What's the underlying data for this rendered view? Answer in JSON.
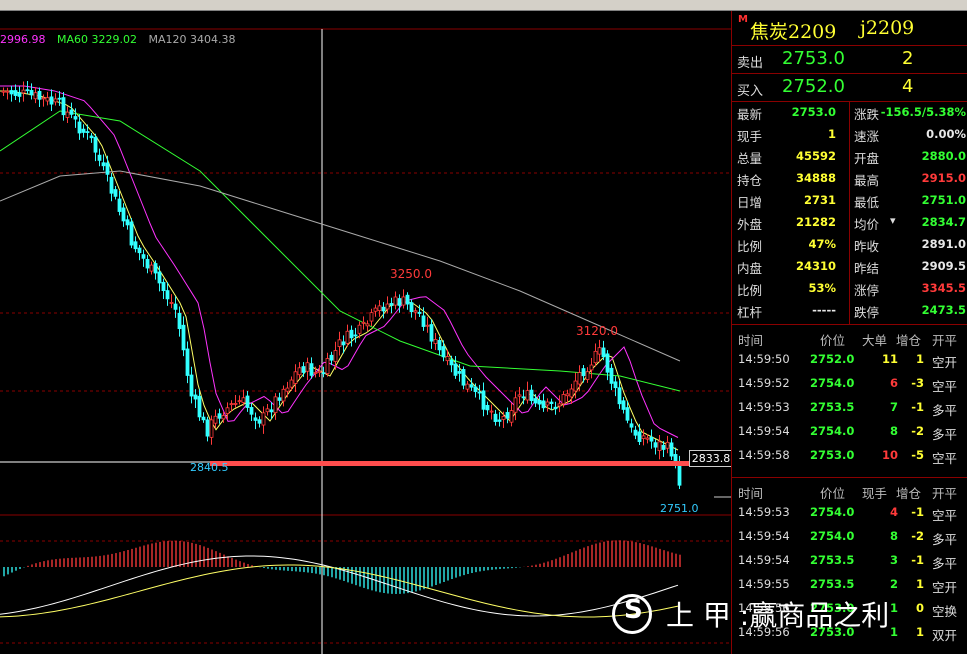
{
  "chart": {
    "ma_legend": [
      {
        "text": "2996.98",
        "color": "#ff33ff"
      },
      {
        "text": "MA60 3229.02",
        "color": "#33ff33"
      },
      {
        "text": "MA120 3404.38",
        "color": "#aaaaaa"
      }
    ],
    "annotations": {
      "high_1": "3250.0",
      "high_2": "3120.0",
      "low_1": "2840.5",
      "last": "2751.0",
      "crosshair_price": "2833.8"
    }
  },
  "quote": {
    "badge": "M",
    "name": "焦炭2209",
    "code": "j2209",
    "ask": {
      "label": "卖出",
      "price": "2753.0",
      "volume": "2"
    },
    "bid": {
      "label": "买入",
      "price": "2752.0",
      "volume": "4"
    },
    "stats": [
      {
        "l1": "最新",
        "v1": "2753.0",
        "c1": "green",
        "l2": "涨跌",
        "v2": "-156.5/5.38%",
        "c2": "green"
      },
      {
        "l1": "现手",
        "v1": "1",
        "c1": "yellow",
        "l2": "速涨",
        "v2": "0.00%",
        "c2": "white"
      },
      {
        "l1": "总量",
        "v1": "45592",
        "c1": "yellow",
        "l2": "开盘",
        "v2": "2880.0",
        "c2": "green"
      },
      {
        "l1": "持仓",
        "v1": "34888",
        "c1": "yellow",
        "l2": "最高",
        "v2": "2915.0",
        "c2": "red"
      },
      {
        "l1": "日增",
        "v1": "2731",
        "c1": "yellow",
        "l2": "最低",
        "v2": "2751.0",
        "c2": "green"
      },
      {
        "l1": "外盘",
        "v1": "21282",
        "c1": "yellow",
        "l2": "均价",
        "v2": "2834.7",
        "c2": "green"
      },
      {
        "l1": "比例",
        "v1": "47%",
        "c1": "yellow",
        "l2": "昨收",
        "v2": "2891.0",
        "c2": "white"
      },
      {
        "l1": "内盘",
        "v1": "24310",
        "c1": "yellow",
        "l2": "昨结",
        "v2": "2909.5",
        "c2": "white"
      },
      {
        "l1": "比例",
        "v1": "53%",
        "c1": "yellow",
        "l2": "涨停",
        "v2": "3345.5",
        "c2": "red"
      },
      {
        "l1": "杠杆",
        "v1": "-----",
        "c1": "white",
        "l2": "跌停",
        "v2": "2473.5",
        "c2": "green"
      }
    ]
  },
  "ticks1": {
    "headers": [
      "时间",
      "价位",
      "大单",
      "增仓",
      "开平"
    ],
    "rows": [
      {
        "time": "14:59:50",
        "price": "2752.0",
        "vol": "11",
        "vc": "yellow",
        "chg": "1",
        "type": "空开"
      },
      {
        "time": "14:59:52",
        "price": "2754.0",
        "vol": "6",
        "vc": "red",
        "chg": "-3",
        "type": "空平"
      },
      {
        "time": "14:59:53",
        "price": "2753.5",
        "vol": "7",
        "vc": "green",
        "chg": "-1",
        "type": "多平"
      },
      {
        "time": "14:59:54",
        "price": "2754.0",
        "vol": "8",
        "vc": "green",
        "chg": "-2",
        "type": "多平"
      },
      {
        "time": "14:59:58",
        "price": "2753.0",
        "vol": "10",
        "vc": "red",
        "chg": "-5",
        "type": "空平"
      }
    ]
  },
  "ticks2": {
    "headers": [
      "时间",
      "价位",
      "现手",
      "增仓",
      "开平"
    ],
    "rows": [
      {
        "time": "14:59:53",
        "price": "2754.0",
        "vol": "4",
        "vc": "red",
        "chg": "-1",
        "type": "空平"
      },
      {
        "time": "14:59:54",
        "price": "2754.0",
        "vol": "8",
        "vc": "green",
        "chg": "-2",
        "type": "多平"
      },
      {
        "time": "14:59:54",
        "price": "2753.5",
        "vol": "3",
        "vc": "green",
        "chg": "-1",
        "type": "多平"
      },
      {
        "time": "14:59:55",
        "price": "2753.5",
        "vol": "2",
        "vc": "green",
        "chg": "1",
        "type": "空开"
      },
      {
        "time": "14:59:56",
        "price": "2753.0",
        "vol": "1",
        "vc": "green",
        "chg": "0",
        "type": "空换"
      },
      {
        "time": "14:59:56",
        "price": "2753.0",
        "vol": "1",
        "vc": "green",
        "chg": "1",
        "type": "双开"
      }
    ]
  },
  "watermark": {
    "text": "上 甲 :赢商品之利"
  }
}
